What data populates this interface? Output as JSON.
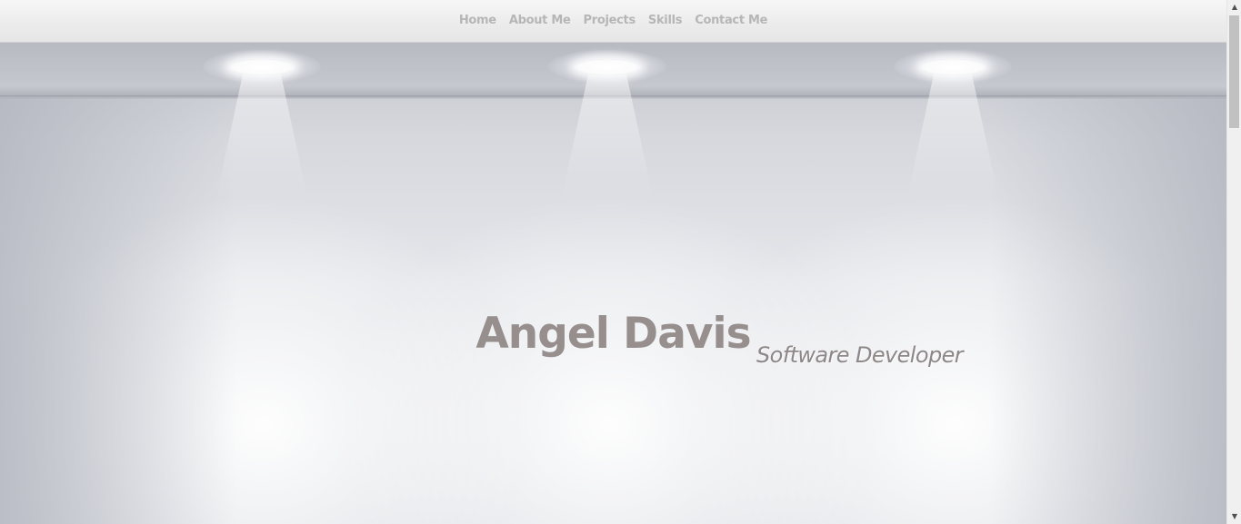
{
  "nav": {
    "items": [
      {
        "label": "Home"
      },
      {
        "label": "About Me"
      },
      {
        "label": "Projects"
      },
      {
        "label": "Skills"
      },
      {
        "label": "Contact Me"
      }
    ]
  },
  "hero": {
    "name": "Angel Davis",
    "role": "Software Developer",
    "name_color": "#978e8e",
    "role_color": "#8e8787"
  },
  "scrollbar": {
    "up_icon": "arrow-up-icon",
    "down_icon": "arrow-down-icon"
  },
  "colors": {
    "nav_link": "#b6b6b6",
    "nav_bg": "#ececec"
  }
}
